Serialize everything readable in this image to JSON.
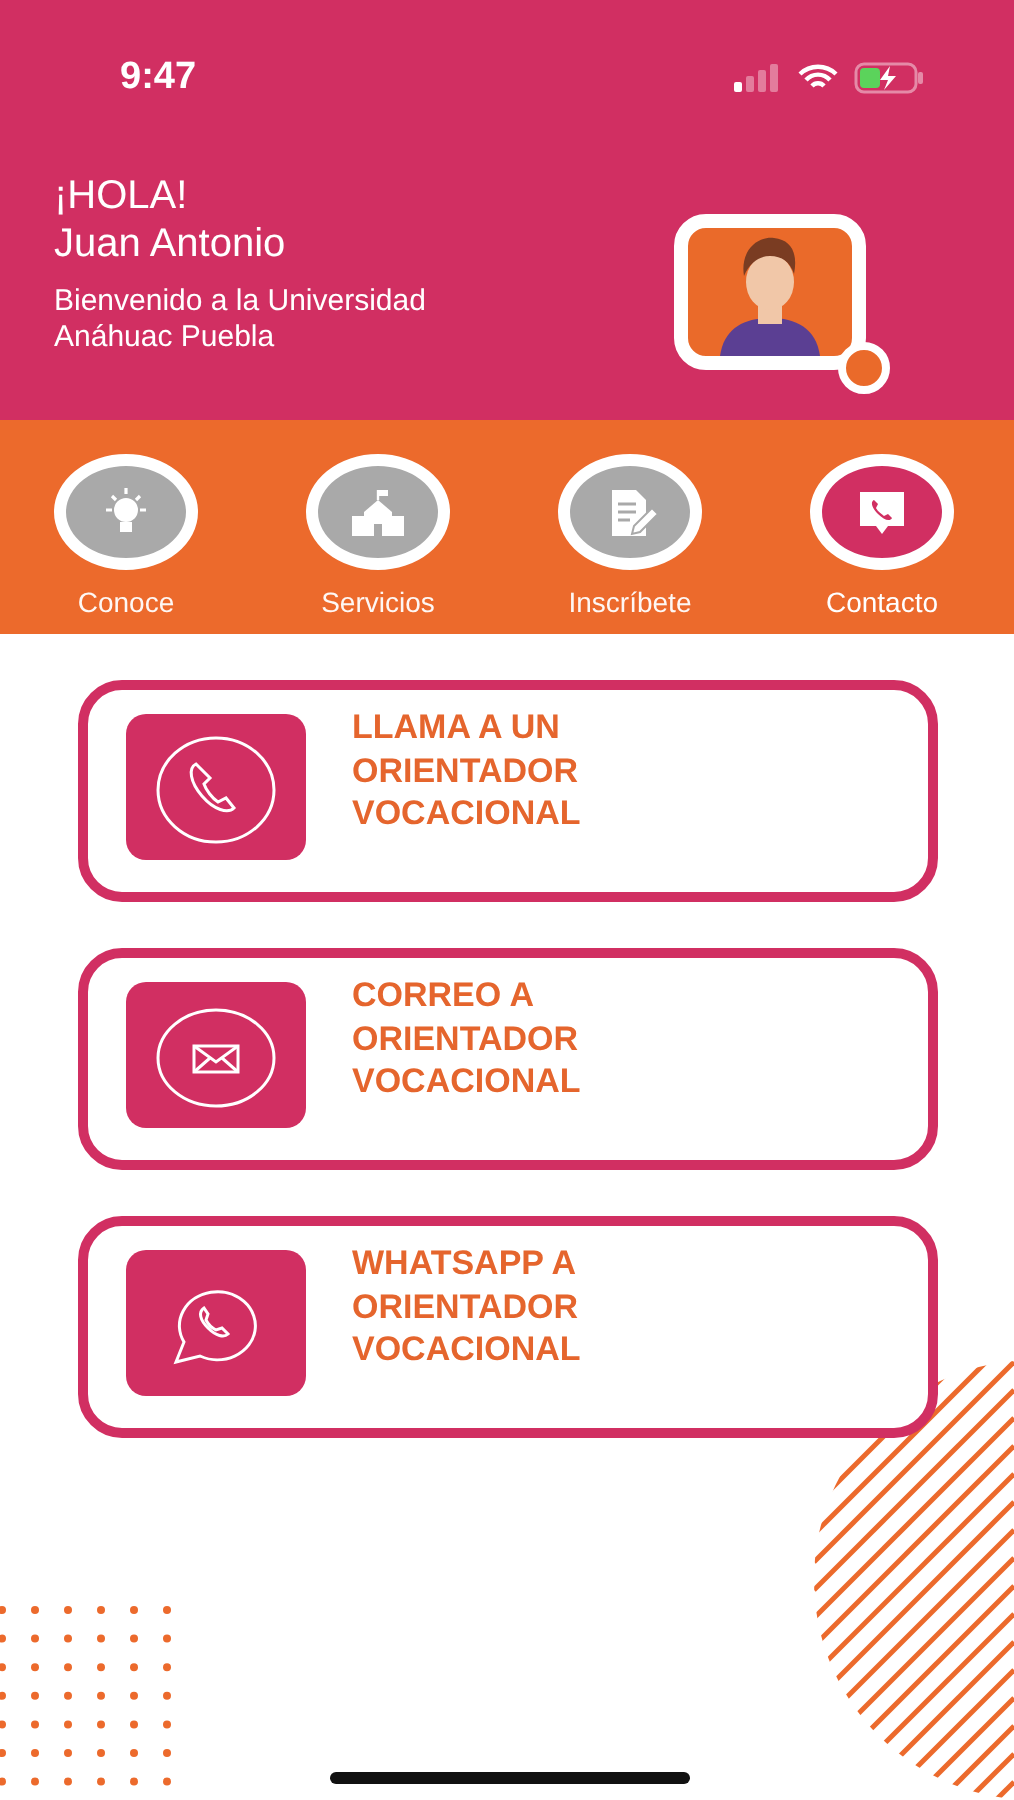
{
  "status_bar": {
    "time": "9:47"
  },
  "header": {
    "greeting": "¡HOLA!",
    "name": "Juan Antonio",
    "subtitle": "Bienvenido a la Universidad\nAnáhuac Puebla"
  },
  "nav": [
    {
      "label": "Conoce",
      "kind": "bulb",
      "selected": false
    },
    {
      "label": "Servicios",
      "kind": "school",
      "selected": false
    },
    {
      "label": "Inscríbete",
      "kind": "form",
      "selected": false
    },
    {
      "label": "Contacto",
      "kind": "chat-phone",
      "selected": true
    }
  ],
  "options": [
    {
      "kind": "phone",
      "title": "LLAMA A UN\nORIENTADOR\nVOCACIONAL"
    },
    {
      "kind": "mail",
      "title": "CORREO A\nORIENTADOR\nVOCACIONAL"
    },
    {
      "kind": "whatsapp",
      "title": "WHATSAPP A\nORIENTADOR\nVOCACIONAL"
    }
  ]
}
